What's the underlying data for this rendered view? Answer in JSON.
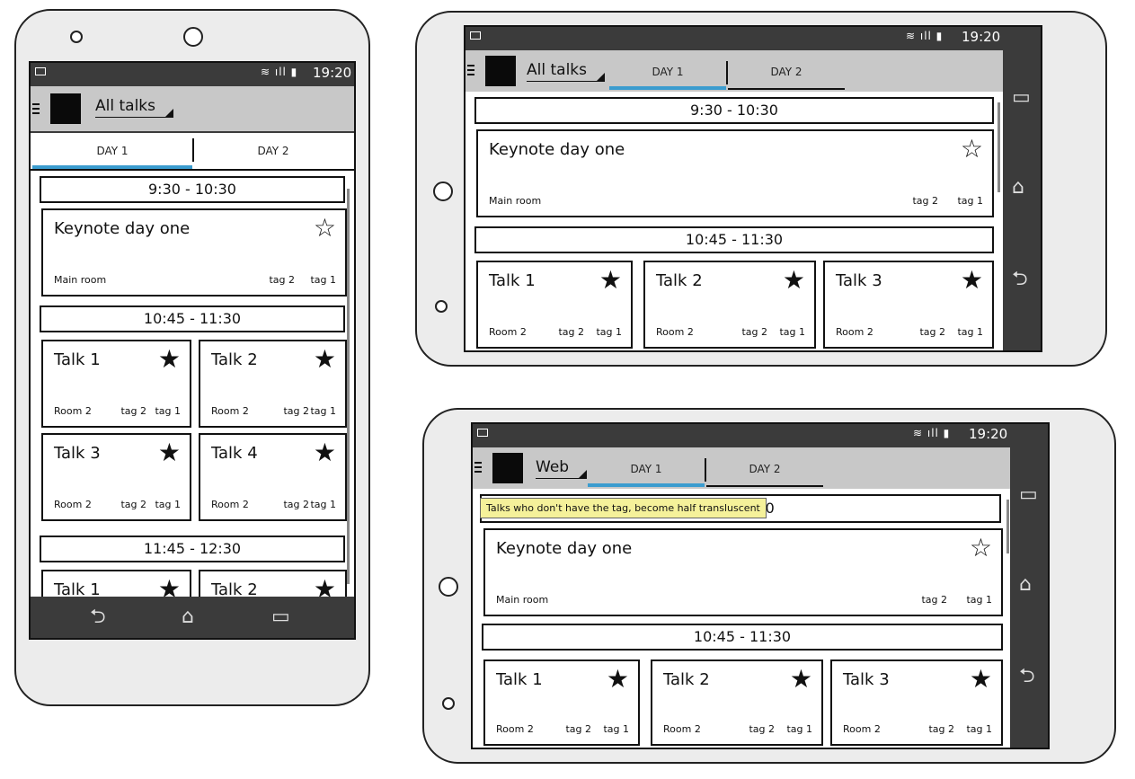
{
  "status": {
    "time": "19:20",
    "signal": "≋ ıll ▮"
  },
  "nav": {
    "back": "⮌",
    "home": "⌂",
    "recents": "▭"
  },
  "phone_portrait": {
    "title": "All talks",
    "tabs": [
      "DAY 1",
      "DAY 2"
    ],
    "slots": [
      "9:30 - 10:30",
      "10:45 - 11:30",
      "11:45 - 12:30"
    ],
    "keynote": {
      "title": "Keynote day one",
      "room": "Main room",
      "tag2": "tag 2",
      "tag1": "tag 1",
      "star": "☆"
    },
    "talks": [
      {
        "title": "Talk 1",
        "room": "Room 2",
        "tag2": "tag 2",
        "tag1": "tag 1",
        "star": "★"
      },
      {
        "title": "Talk 2",
        "room": "Room 2",
        "tag2": "tag 2",
        "tag1": "tag 1",
        "star": "★"
      },
      {
        "title": "Talk 3",
        "room": "Room 2",
        "tag2": "tag 2",
        "tag1": "tag 1",
        "star": "★"
      },
      {
        "title": "Talk 4",
        "room": "Room 2",
        "tag2": "tag 2",
        "tag1": "tag 1",
        "star": "★"
      },
      {
        "title": "Talk 1",
        "star": "★"
      },
      {
        "title": "Talk 2",
        "star": "★"
      }
    ]
  },
  "phone_landscape_top": {
    "title": "All talks",
    "tabs": [
      "DAY 1",
      "DAY 2"
    ],
    "slots": [
      "9:30 - 10:30",
      "10:45 - 11:30"
    ],
    "keynote": {
      "title": "Keynote day one",
      "room": "Main room",
      "tag2": "tag 2",
      "tag1": "tag 1",
      "star": "☆"
    },
    "talks": [
      {
        "title": "Talk 1",
        "room": "Room 2",
        "tag2": "tag 2",
        "tag1": "tag 1",
        "star": "★"
      },
      {
        "title": "Talk 2",
        "room": "Room 2",
        "tag2": "tag 2",
        "tag1": "tag 1",
        "star": "★"
      },
      {
        "title": "Talk 3",
        "room": "Room 2",
        "tag2": "tag 2",
        "tag1": "tag 1",
        "star": "★"
      }
    ]
  },
  "phone_landscape_bottom": {
    "title": "Web",
    "tabs": [
      "DAY 1",
      "DAY 2"
    ],
    "slots": [
      ":30",
      "10:45 - 11:30"
    ],
    "tooltip": "Talks who don't have the tag, become half transluscent",
    "keynote": {
      "title": "Keynote day one",
      "room": "Main room",
      "tag2": "tag 2",
      "tag1": "tag 1",
      "star": "☆"
    },
    "talks": [
      {
        "title": "Talk 1",
        "room": "Room 2",
        "tag2": "tag 2",
        "tag1": "tag 1",
        "star": "★"
      },
      {
        "title": "Talk 2",
        "room": "Room 2",
        "tag2": "tag 2",
        "tag1": "tag 1",
        "star": "★"
      },
      {
        "title": "Talk 3",
        "room": "Room 2",
        "tag2": "tag 2",
        "tag1": "tag 1",
        "star": "★"
      }
    ]
  }
}
